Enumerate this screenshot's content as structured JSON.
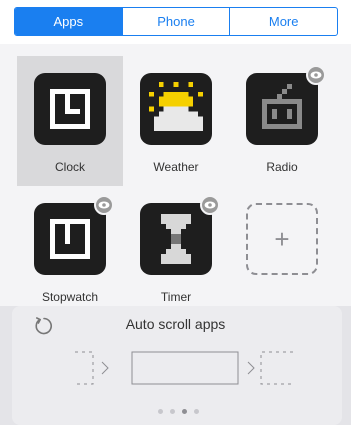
{
  "tabs": [
    {
      "label": "Apps",
      "active": true
    },
    {
      "label": "Phone",
      "active": false
    },
    {
      "label": "More",
      "active": false
    }
  ],
  "apps": [
    {
      "label": "Clock",
      "icon": "clock-icon",
      "selected": true,
      "hidden": false
    },
    {
      "label": "Weather",
      "icon": "weather-icon",
      "selected": false,
      "hidden": false
    },
    {
      "label": "Radio",
      "icon": "radio-icon",
      "selected": false,
      "hidden": true
    },
    {
      "label": "Stopwatch",
      "icon": "stopwatch-icon",
      "selected": false,
      "hidden": true
    },
    {
      "label": "Timer",
      "icon": "timer-icon",
      "selected": false,
      "hidden": true
    }
  ],
  "add_tile": {
    "symbol": "+"
  },
  "auto_scroll": {
    "title": "Auto scroll apps",
    "icon": "refresh-icon"
  },
  "pager": {
    "total": 4,
    "current": 3
  },
  "colors": {
    "accent": "#1a7ff0",
    "icon_bg": "#1e1e1e",
    "weather_sun": "#f5d000"
  }
}
